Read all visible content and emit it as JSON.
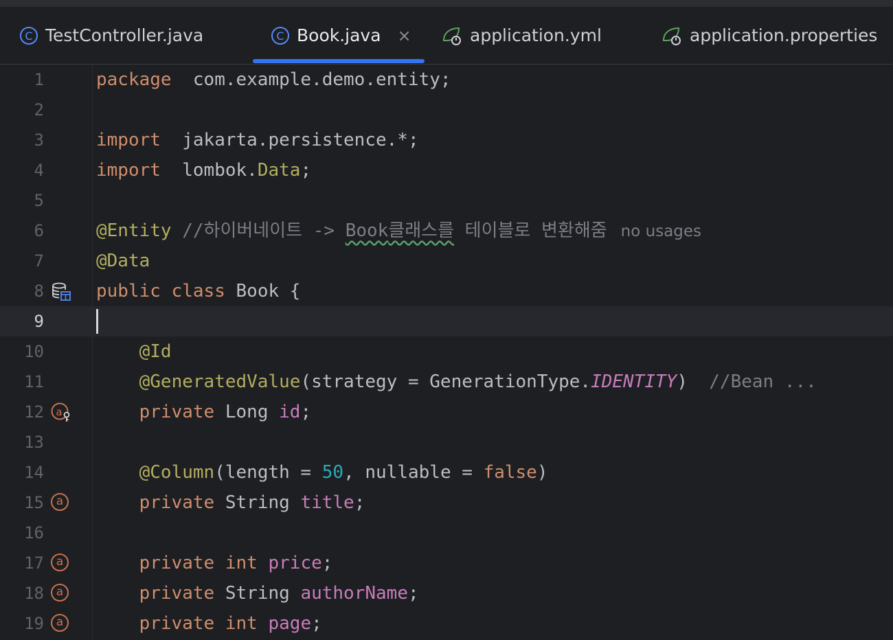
{
  "tabs": [
    {
      "label": "TestController.java",
      "icon": "java-class-icon",
      "active": false
    },
    {
      "label": "Book.java",
      "icon": "java-class-icon",
      "active": true,
      "close": "×"
    },
    {
      "label": "application.yml",
      "icon": "spring-config-icon",
      "active": false
    },
    {
      "label": "application.properties",
      "icon": "spring-config-icon",
      "active": false
    }
  ],
  "editor": {
    "current_line": 9,
    "lines": [
      {
        "n": "1",
        "segments": [
          [
            "kw",
            "package"
          ],
          [
            "",
            "  com.example.demo.entity;"
          ]
        ]
      },
      {
        "n": "2",
        "segments": []
      },
      {
        "n": "3",
        "segments": [
          [
            "kw",
            "import"
          ],
          [
            "",
            "  jakarta.persistence.*;"
          ]
        ]
      },
      {
        "n": "4",
        "segments": [
          [
            "kw",
            "import"
          ],
          [
            "",
            "  lombok."
          ],
          [
            "cls",
            "Data"
          ],
          [
            "",
            ";"
          ]
        ]
      },
      {
        "n": "5",
        "segments": []
      },
      {
        "n": "6",
        "segments": [
          [
            "ann",
            "@Entity"
          ],
          [
            "",
            " "
          ],
          [
            "cmt",
            "//하이버네이트 -> "
          ],
          [
            "cmt typo",
            "Book"
          ],
          [
            "cmt typo",
            "클래스를"
          ],
          [
            "cmt",
            " 테이블로 변환해줌"
          ]
        ],
        "hint": "no usages"
      },
      {
        "n": "7",
        "segments": [
          [
            "ann",
            "@Data"
          ]
        ]
      },
      {
        "n": "8",
        "segments": [
          [
            "kw",
            "public"
          ],
          [
            "",
            " "
          ],
          [
            "kw",
            "class"
          ],
          [
            "",
            " Book {"
          ]
        ],
        "gutter_icon": "database-table-icon"
      },
      {
        "n": "9",
        "segments": [],
        "caret": true
      },
      {
        "n": "10",
        "segments": [
          [
            "",
            "    "
          ],
          [
            "ann",
            "@Id"
          ]
        ]
      },
      {
        "n": "11",
        "segments": [
          [
            "",
            "    "
          ],
          [
            "ann",
            "@GeneratedValue"
          ],
          [
            "",
            "(strategy = GenerationType."
          ],
          [
            "cst",
            "IDENTITY"
          ],
          [
            "",
            ")  "
          ],
          [
            "cmt",
            "//Bean ..."
          ]
        ]
      },
      {
        "n": "12",
        "segments": [
          [
            "",
            "    "
          ],
          [
            "kw",
            "private"
          ],
          [
            "",
            " Long "
          ],
          [
            "fld",
            "id"
          ],
          [
            "",
            ";"
          ]
        ],
        "gutter_icon": "id-field-icon"
      },
      {
        "n": "13",
        "segments": []
      },
      {
        "n": "14",
        "segments": [
          [
            "",
            "    "
          ],
          [
            "ann",
            "@Column"
          ],
          [
            "",
            "(length = "
          ],
          [
            "num",
            "50"
          ],
          [
            "",
            ", nullable = "
          ],
          [
            "kw",
            "false"
          ],
          [
            "",
            ")"
          ]
        ]
      },
      {
        "n": "15",
        "segments": [
          [
            "",
            "    "
          ],
          [
            "kw",
            "private"
          ],
          [
            "",
            " String "
          ],
          [
            "fld",
            "title"
          ],
          [
            "",
            ";"
          ]
        ],
        "gutter_icon": "attribute-icon"
      },
      {
        "n": "16",
        "segments": []
      },
      {
        "n": "17",
        "segments": [
          [
            "",
            "    "
          ],
          [
            "kw",
            "private"
          ],
          [
            "",
            " "
          ],
          [
            "kw",
            "int"
          ],
          [
            "",
            " "
          ],
          [
            "fld",
            "price"
          ],
          [
            "",
            ";"
          ]
        ],
        "gutter_icon": "attribute-icon"
      },
      {
        "n": "18",
        "segments": [
          [
            "",
            "    "
          ],
          [
            "kw",
            "private"
          ],
          [
            "",
            " String "
          ],
          [
            "fld",
            "authorName"
          ],
          [
            "",
            ";"
          ]
        ],
        "gutter_icon": "attribute-icon"
      },
      {
        "n": "19",
        "segments": [
          [
            "",
            "    "
          ],
          [
            "kw",
            "private"
          ],
          [
            "",
            " "
          ],
          [
            "kw",
            "int"
          ],
          [
            "",
            " "
          ],
          [
            "fld",
            "page"
          ],
          [
            "",
            ";"
          ]
        ],
        "gutter_icon": "attribute-icon"
      }
    ]
  },
  "colors": {
    "background": "#1e1f22",
    "keyword": "#cf8e6d",
    "annotation": "#b3ae60",
    "field": "#c77dbb",
    "number": "#2aacb8",
    "comment": "#7a7e85",
    "accent": "#3574f0"
  }
}
